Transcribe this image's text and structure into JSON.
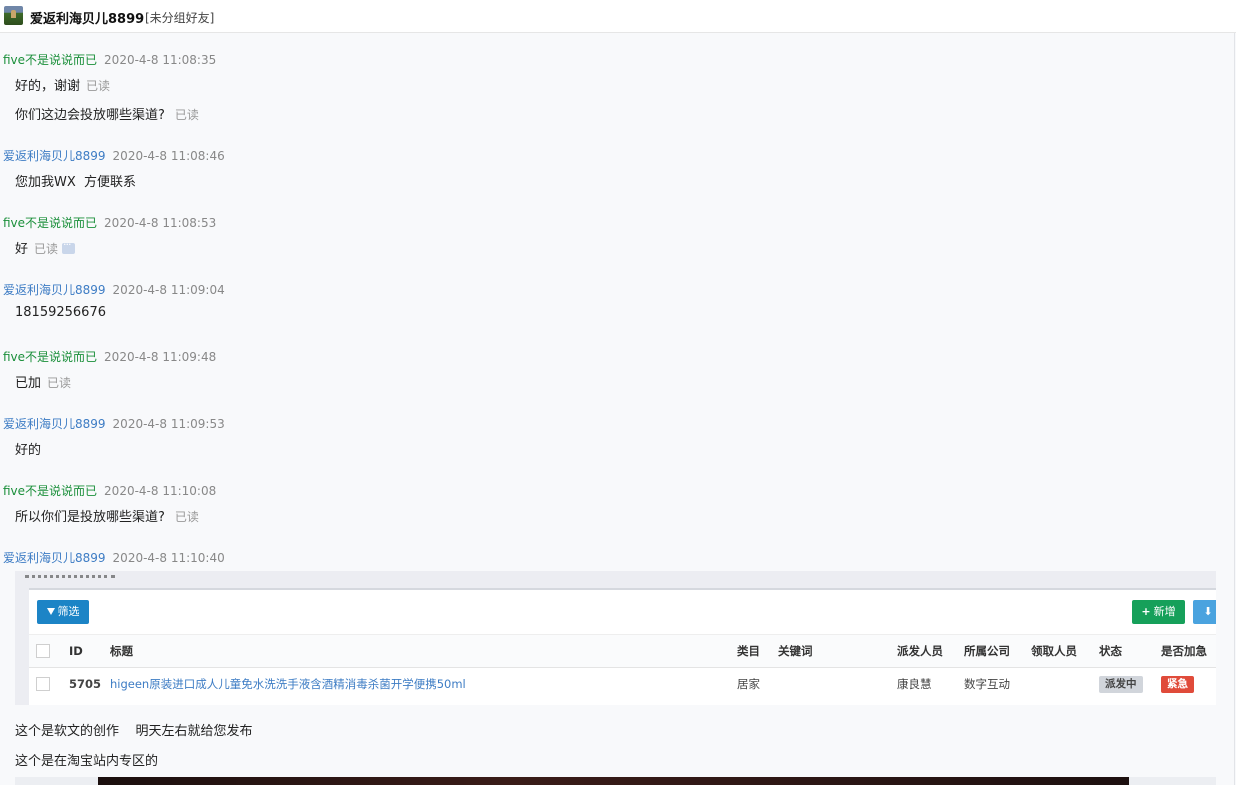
{
  "header": {
    "contact_name": "爱返利海贝儿8899",
    "contact_group": "[未分组好友]"
  },
  "messages": [
    {
      "sender": "five不是说说而已",
      "time": "2020-4-8 11:08:35",
      "lines": [
        {
          "text": "好的，谢谢",
          "read": "已读"
        },
        {
          "text": "你们这边会投放哪些渠道?",
          "read": "已读"
        }
      ]
    },
    {
      "sender": "爱返利海贝儿8899",
      "time": "2020-4-8 11:08:46",
      "lines": [
        {
          "text": "您加我WX  方便联系"
        }
      ]
    },
    {
      "sender": "five不是说说而已",
      "time": "2020-4-8 11:08:53",
      "lines": [
        {
          "text": "好",
          "read": "已读"
        }
      ]
    },
    {
      "sender": "爱返利海贝儿8899",
      "time": "2020-4-8 11:09:04",
      "lines": [
        {
          "text": "18159256676"
        }
      ]
    },
    {
      "sender": "five不是说说而已",
      "time": "2020-4-8 11:09:48",
      "lines": [
        {
          "text": "已加",
          "read": "已读"
        }
      ]
    },
    {
      "sender": "爱返利海贝儿8899",
      "time": "2020-4-8 11:09:53",
      "lines": [
        {
          "text": "好的"
        }
      ]
    },
    {
      "sender": "five不是说说而已",
      "time": "2020-4-8 11:10:08",
      "lines": [
        {
          "text": "所以你们是投放哪些渠道?",
          "read": "已读"
        }
      ]
    },
    {
      "sender": "爱返利海贝儿8899",
      "time": "2020-4-8 11:10:40",
      "lines": [
        {
          "text": "这个是软文的创作    明天左右就给您发布"
        },
        {
          "text": "这个是在淘宝站内专区的"
        }
      ]
    }
  ],
  "shot": {
    "filter_label": "筛选",
    "add_label": "新增",
    "columns": [
      "ID",
      "标题",
      "类目",
      "关键词",
      "派发人员",
      "所属公司",
      "领取人员",
      "状态",
      "是否加急"
    ],
    "row": {
      "id": "5705",
      "title": "higeen原装进口成人儿童免水洗洗手液含酒精消毒杀菌开学便携50ml",
      "category": "居家",
      "keyword": "",
      "dispatcher": "康良慧",
      "company": "数字互动",
      "receiver": "",
      "status": "派发中",
      "urgent": "紧急"
    },
    "colors": {
      "filter": "#1c84c6",
      "add": "#16a05a",
      "urgent": "#e04b3a"
    }
  },
  "colors": {
    "sender_me": "#1a8f3a",
    "sender_peer": "#3d7cc4"
  },
  "icons": [
    "filter-icon",
    "plus-icon",
    "download-icon",
    "more-icon"
  ]
}
